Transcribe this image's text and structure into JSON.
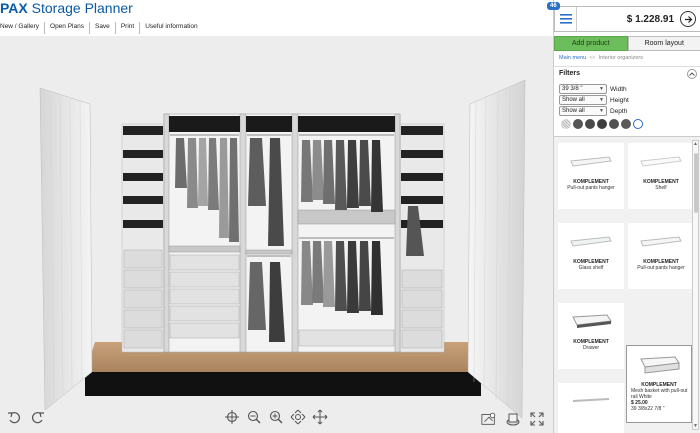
{
  "app": {
    "title_bold": "PAX",
    "title_rest": " Storage Planner"
  },
  "menu": [
    "New / Gallery",
    "Open Plans",
    "Save",
    "Print",
    "Useful information"
  ],
  "cart": {
    "badge": "46",
    "price": "$ 1.228.91"
  },
  "tabs": {
    "add_product": "Add product",
    "room_layout": "Room layout"
  },
  "breadcrumb": {
    "main": "Main menu",
    "separator": "<<",
    "current": "Interior organizers"
  },
  "filters": {
    "title": "Filters",
    "width": {
      "value": "39 3/8 \"",
      "label": "Width"
    },
    "height": {
      "value": "Show all",
      "label": "Height"
    },
    "depth": {
      "value": "Show all",
      "label": "Depth"
    },
    "swatches": [
      "#c9c9c9",
      "#555555",
      "#4a4a4a",
      "#3f3f3f",
      "#505050",
      "#5a5a5a",
      "#ffffff"
    ]
  },
  "products": [
    {
      "name": "KOMPLEMENT",
      "desc": "Pull-out pants hanger"
    },
    {
      "name": "KOMPLEMENT",
      "desc": "Shelf"
    },
    {
      "name": "KOMPLEMENT",
      "desc": "Glass shelf"
    },
    {
      "name": "KOMPLEMENT",
      "desc": "Pull-out pants hanger"
    },
    {
      "name": "KOMPLEMENT",
      "desc": "Drawer"
    },
    {
      "name": "KOMPLEMENT",
      "desc": "Mesh basket with pull-out rail White",
      "price": "$ 25.00",
      "dims": "39 3/8x22 7/8 \""
    }
  ],
  "icons": {
    "undo": "undo-icon",
    "redo": "redo-icon",
    "target": "target-icon",
    "zoom_out": "zoom-out-icon",
    "zoom_in": "zoom-in-icon",
    "rotate": "rotate-icon",
    "pan": "pan-icon",
    "measure": "measure-icon",
    "doors": "doors-toggle-icon",
    "fullscreen": "fullscreen-icon"
  }
}
